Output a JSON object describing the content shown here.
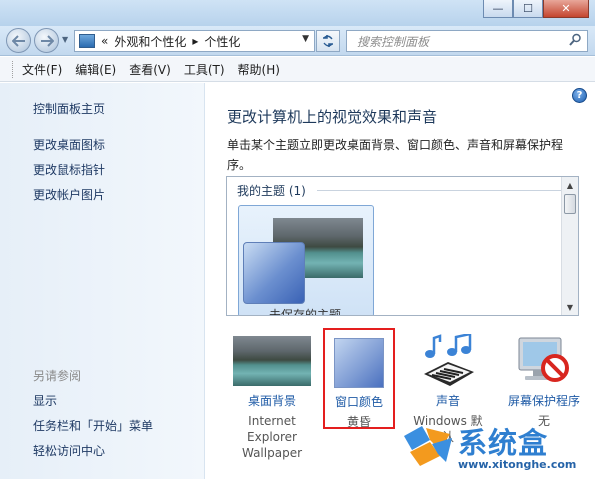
{
  "window": {
    "minimize_glyph": "—",
    "maximize_glyph": "☐",
    "close_glyph": "✕"
  },
  "address": {
    "overflow": "«",
    "crumbs": [
      "外观和个性化",
      "个性化"
    ],
    "separator": "▸",
    "search_placeholder": "搜索控制面板"
  },
  "menu": [
    "文件(F)",
    "编辑(E)",
    "查看(V)",
    "工具(T)",
    "帮助(H)"
  ],
  "sidebar": {
    "home": "控制面板主页",
    "links": [
      "更改桌面图标",
      "更改鼠标指针",
      "更改帐户图片"
    ],
    "see_also_title": "另请参阅",
    "see_also": [
      "显示",
      "任务栏和「开始」菜单",
      "轻松访问中心"
    ]
  },
  "main": {
    "help": "?",
    "heading": "更改计算机上的视觉效果和声音",
    "description": "单击某个主题立即更改桌面背景、窗口颜色、声音和屏幕保护程序。",
    "my_themes": "我的主题 (1)",
    "theme_caption": "未保存的主题",
    "tiles": {
      "background": {
        "label": "桌面背景",
        "sub": [
          "Internet",
          "Explorer",
          "Wallpaper"
        ]
      },
      "color": {
        "label": "窗口颜色",
        "sub": "黄昏"
      },
      "sound": {
        "label": "声音",
        "sub": "Windows 默认"
      },
      "saver": {
        "label": "屏幕保护程序",
        "sub": "无"
      }
    }
  },
  "watermark": {
    "name": "系统盒",
    "url": "www.xitonghe.com"
  },
  "colors": {
    "link": "#1f5ba6",
    "heading": "#1e395b",
    "highlight_border": "#e41e1e",
    "watermark": "#2f7fd0"
  }
}
